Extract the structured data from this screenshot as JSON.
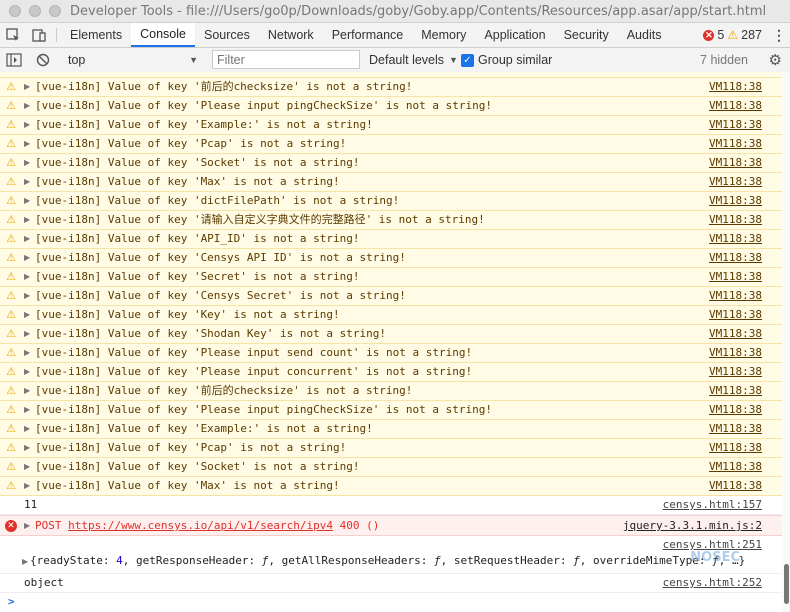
{
  "window": {
    "title": "Developer Tools - file:///Users/go0p/Downloads/goby/Goby.app/Contents/Resources/app.asar/app/start.html"
  },
  "tabs": [
    {
      "label": "Elements",
      "active": false
    },
    {
      "label": "Console",
      "active": true
    },
    {
      "label": "Sources",
      "active": false
    },
    {
      "label": "Network",
      "active": false
    },
    {
      "label": "Performance",
      "active": false
    },
    {
      "label": "Memory",
      "active": false
    },
    {
      "label": "Application",
      "active": false
    },
    {
      "label": "Security",
      "active": false
    },
    {
      "label": "Audits",
      "active": false
    }
  ],
  "badges": {
    "errors": "5",
    "warnings": "287"
  },
  "toolbar": {
    "context": "top",
    "filter_placeholder": "Filter",
    "levels": "Default levels",
    "group_similar": "Group similar",
    "hidden": "7 hidden"
  },
  "messages": [
    {
      "type": "warn",
      "text": "[vue-i18n] Value of key '前后的checksize' is not a string!",
      "source": "VM118:38"
    },
    {
      "type": "warn",
      "text": "[vue-i18n] Value of key 'Please input pingCheckSize' is not a string!",
      "source": "VM118:38"
    },
    {
      "type": "warn",
      "text": "[vue-i18n] Value of key 'Example:' is not a string!",
      "source": "VM118:38"
    },
    {
      "type": "warn",
      "text": "[vue-i18n] Value of key 'Pcap' is not a string!",
      "source": "VM118:38"
    },
    {
      "type": "warn",
      "text": "[vue-i18n] Value of key 'Socket' is not a string!",
      "source": "VM118:38"
    },
    {
      "type": "warn",
      "text": "[vue-i18n] Value of key 'Max' is not a string!",
      "source": "VM118:38"
    },
    {
      "type": "warn",
      "text": "[vue-i18n] Value of key 'dictFilePath' is not a string!",
      "source": "VM118:38"
    },
    {
      "type": "warn",
      "text": "[vue-i18n] Value of key '请输入自定义字典文件的完整路径' is not a string!",
      "source": "VM118:38"
    },
    {
      "type": "warn",
      "text": "[vue-i18n] Value of key 'API_ID' is not a string!",
      "source": "VM118:38"
    },
    {
      "type": "warn",
      "text": "[vue-i18n] Value of key 'Censys API ID' is not a string!",
      "source": "VM118:38"
    },
    {
      "type": "warn",
      "text": "[vue-i18n] Value of key 'Secret' is not a string!",
      "source": "VM118:38"
    },
    {
      "type": "warn",
      "text": "[vue-i18n] Value of key 'Censys Secret' is not a string!",
      "source": "VM118:38"
    },
    {
      "type": "warn",
      "text": "[vue-i18n] Value of key 'Key' is not a string!",
      "source": "VM118:38"
    },
    {
      "type": "warn",
      "text": "[vue-i18n] Value of key 'Shodan Key' is not a string!",
      "source": "VM118:38"
    },
    {
      "type": "warn",
      "text": "[vue-i18n] Value of key 'Please input send count' is not a string!",
      "source": "VM118:38"
    },
    {
      "type": "warn",
      "text": "[vue-i18n] Value of key 'Please input concurrent' is not a string!",
      "source": "VM118:38"
    },
    {
      "type": "warn",
      "text": "[vue-i18n] Value of key '前后的checksize' is not a string!",
      "source": "VM118:38"
    },
    {
      "type": "warn",
      "text": "[vue-i18n] Value of key 'Please input pingCheckSize' is not a string!",
      "source": "VM118:38"
    },
    {
      "type": "warn",
      "text": "[vue-i18n] Value of key 'Example:' is not a string!",
      "source": "VM118:38"
    },
    {
      "type": "warn",
      "text": "[vue-i18n] Value of key 'Pcap' is not a string!",
      "source": "VM118:38"
    },
    {
      "type": "warn",
      "text": "[vue-i18n] Value of key 'Socket' is not a string!",
      "source": "VM118:38"
    },
    {
      "type": "warn",
      "text": "[vue-i18n] Value of key 'Max' is not a string!",
      "source": "VM118:38"
    }
  ],
  "log_11": {
    "text": "11",
    "source": "censys.html:157"
  },
  "error_post": {
    "method": "POST",
    "url": "https://www.censys.io/api/v1/search/ipv4",
    "status": "400 ()",
    "source": "jquery-3.3.1.min.js:2"
  },
  "object_log": {
    "source": "censys.html:251",
    "text_a": "{readyState: ",
    "num": "4",
    "text_b": ", getResponseHeader: ",
    "f1": "ƒ",
    "text_c": ", getAllResponseHeaders: ",
    "f2": "ƒ",
    "text_d": ", setRequestHeader: ",
    "f3": "ƒ",
    "text_e": ", overrideMimeType: ",
    "f4": "ƒ",
    "text_f": ", …}"
  },
  "object_str": {
    "text": "object",
    "source": "censys.html:252"
  },
  "prompt": ">",
  "watermark": "NOSEC"
}
